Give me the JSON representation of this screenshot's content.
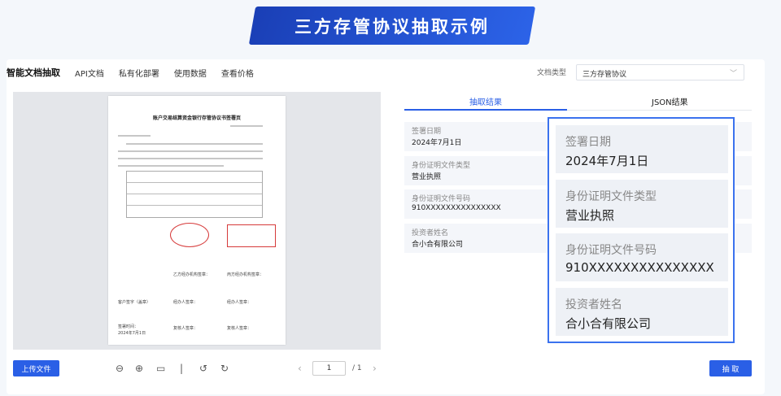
{
  "banner": {
    "title": "三方存管协议抽取示例"
  },
  "nav": {
    "items": [
      "智能文档抽取",
      "API文档",
      "私有化部署",
      "使用数据",
      "查看价格"
    ]
  },
  "doc_type": {
    "label": "文档类型",
    "value": "三方存管协议"
  },
  "preview": {
    "doc_title": "账户交易结算资金银行存管协议书签署页",
    "labels": {
      "investor_sign": "客户签字（盖章）",
      "agent1": "经办人签章：",
      "agent2": "经办人签章：",
      "date_label": "签署时间：",
      "date": "2024年7月1日",
      "reviewer1": "复核人签章：",
      "reviewer2": "复核人签章：",
      "party_b": "乙方经办机构签章：",
      "party_c": "丙方经办机构签章："
    }
  },
  "toolbar": {
    "upload": "上传文件",
    "page_current": "1",
    "page_total": "/ 1",
    "icons": [
      "zoom-out-icon",
      "zoom-in-icon",
      "fit-icon",
      "divider-icon",
      "rotate-left-icon",
      "rotate-right-icon"
    ]
  },
  "tabs": {
    "extract": "抽取结果",
    "json": "JSON结果"
  },
  "fields": [
    {
      "label": "签署日期",
      "value": "2024年7月1日"
    },
    {
      "label": "身份证明文件类型",
      "value": "营业执照"
    },
    {
      "label": "身份证明文件号码",
      "value": "910XXXXXXXXXXXXXXX"
    },
    {
      "label": "投资者姓名",
      "value": "合小合有限公司"
    }
  ],
  "zoom_fields": [
    {
      "label": "签署日期",
      "value": "2024年7月1日"
    },
    {
      "label": "身份证明文件类型",
      "value": "营业执照"
    },
    {
      "label": "身份证明文件号码",
      "value": "910XXXXXXXXXXXXXXX"
    },
    {
      "label": "投资者姓名",
      "value": "合小合有限公司"
    }
  ],
  "actions": {
    "extract": "抽 取"
  },
  "colors": {
    "primary": "#2a5fe6",
    "banner": "#1a3fb6"
  }
}
